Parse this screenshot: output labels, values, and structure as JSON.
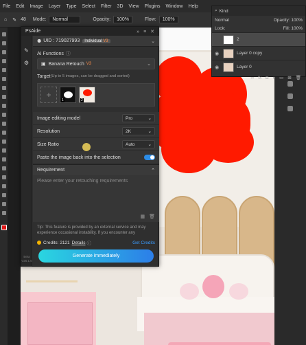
{
  "menubar": {
    "items": [
      "File",
      "Edit",
      "Image",
      "Layer",
      "Type",
      "Select",
      "Filter",
      "3D",
      "View",
      "Plugins",
      "Window",
      "Help"
    ]
  },
  "optbar": {
    "brush_size": "48",
    "mode_label": "Mode:",
    "mode_value": "Normal",
    "opacity_label": "Opacity:",
    "opacity_value": "100%",
    "flow_label": "Flow:",
    "flow_value": "100%"
  },
  "layers_panel": {
    "kind_label": "Kind",
    "blend_mode": "Normal",
    "opacity_label": "Opacity:",
    "opacity_value": "100%",
    "lock_label": "Lock:",
    "fill_label": "Fill:",
    "fill_value": "100%",
    "layers": [
      {
        "name": "2",
        "selected": true,
        "visible": false
      },
      {
        "name": "Layer 0 copy",
        "selected": false,
        "visible": true
      },
      {
        "name": "Layer 0",
        "selected": false,
        "visible": true
      }
    ]
  },
  "psaide": {
    "title": "PsAide",
    "uid_text": "UID : 719027993",
    "plan_badge": "Individual",
    "plan_tier": "V3",
    "version": "Beta V26.1.0",
    "ai_functions_label": "AI Functions",
    "function_value": "Banana Retouch",
    "function_tag": "V3",
    "target_label": "Target",
    "target_hint": "(Up to 5 images, can be dragged and sorted)",
    "target_slots": [
      "1",
      "2"
    ],
    "editing_model_label": "Image editing model",
    "editing_model_value": "Pro",
    "resolution_label": "Resolution",
    "resolution_value": "2K",
    "size_ratio_label": "Size Ratio",
    "size_ratio_value": "Auto",
    "paste_back_label": "Paste the image back into the selection",
    "paste_back_enabled": true,
    "requirement_label": "Requirement",
    "requirement_placeholder": "Please enter your retouching requirements",
    "tip_text": "Tip: This feature is provided by an external service and may experience occasional instability. If you encounter any",
    "credits_text": "Credits: 2121",
    "details_link": "Details",
    "get_credits_link": "Get Credits",
    "generate_button": "Generate immediately"
  },
  "colors": {
    "accent_blue": "#2c8ce6",
    "generate_gradient_start": "#2ad6e0",
    "generate_gradient_end": "#2c7ee8",
    "selection_red": "#ff1a00"
  }
}
